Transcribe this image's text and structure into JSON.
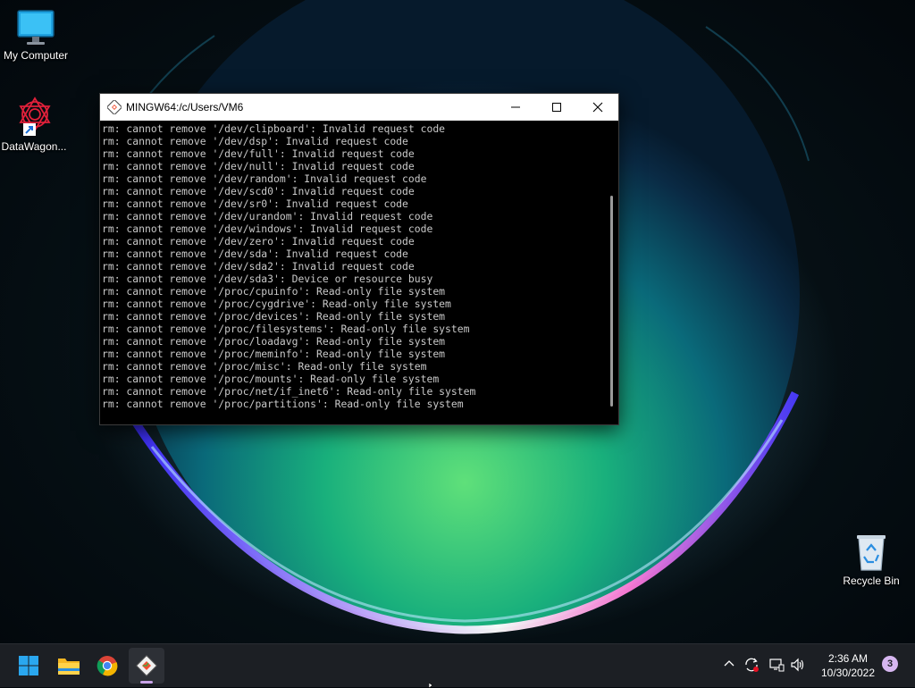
{
  "desktop": {
    "icons": [
      {
        "label": "My Computer",
        "icon": "monitor-icon"
      },
      {
        "label": "DataWagon...",
        "icon": "datawagon-shortcut-icon"
      },
      {
        "label": "Recycle Bin",
        "icon": "recycle-bin-icon"
      }
    ]
  },
  "window": {
    "title": "MINGW64:/c/Users/VM6",
    "icon": "git-bash-icon",
    "controls": [
      "minimize-icon",
      "maximize-icon",
      "close-icon"
    ]
  },
  "terminal": {
    "lines": [
      "rm: cannot remove '/dev/clipboard': Invalid request code",
      "rm: cannot remove '/dev/dsp': Invalid request code",
      "rm: cannot remove '/dev/full': Invalid request code",
      "rm: cannot remove '/dev/null': Invalid request code",
      "rm: cannot remove '/dev/random': Invalid request code",
      "rm: cannot remove '/dev/scd0': Invalid request code",
      "rm: cannot remove '/dev/sr0': Invalid request code",
      "rm: cannot remove '/dev/urandom': Invalid request code",
      "rm: cannot remove '/dev/windows': Invalid request code",
      "rm: cannot remove '/dev/zero': Invalid request code",
      "rm: cannot remove '/dev/sda': Invalid request code",
      "rm: cannot remove '/dev/sda2': Invalid request code",
      "rm: cannot remove '/dev/sda3': Device or resource busy",
      "rm: cannot remove '/proc/cpuinfo': Read-only file system",
      "rm: cannot remove '/proc/cygdrive': Read-only file system",
      "rm: cannot remove '/proc/devices': Read-only file system",
      "rm: cannot remove '/proc/filesystems': Read-only file system",
      "rm: cannot remove '/proc/loadavg': Read-only file system",
      "rm: cannot remove '/proc/meminfo': Read-only file system",
      "rm: cannot remove '/proc/misc': Read-only file system",
      "rm: cannot remove '/proc/mounts': Read-only file system",
      "rm: cannot remove '/proc/net/if_inet6': Read-only file system",
      "rm: cannot remove '/proc/partitions': Read-only file system"
    ]
  },
  "taskbar": {
    "apps": [
      "windows-start-icon",
      "file-explorer-icon",
      "chrome-icon",
      "git-bash-icon"
    ],
    "tray_icons": [
      "chevron-up-icon",
      "sync-icon",
      "network-icon",
      "volume-icon"
    ],
    "time": "2:36 AM",
    "date": "10/30/2022",
    "notification_count": "3"
  },
  "colors": {
    "terminal_bg": "#000000",
    "terminal_fg": "#c9c9c9",
    "taskbar_bg": "#1c1f24",
    "badge": "#d6b6f0"
  }
}
